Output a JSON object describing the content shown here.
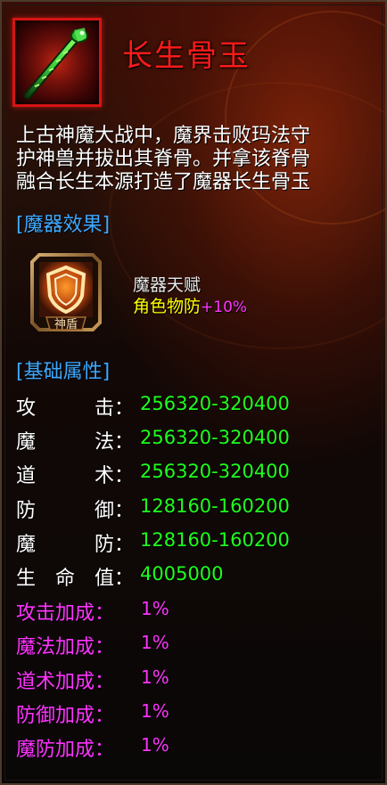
{
  "item": {
    "name": "长生骨玉",
    "icon": "green-bone-staff-icon",
    "description_lines": [
      "上古神魔大战中，魔界击败玛法守",
      "护神兽并拔出其脊骨。并拿该脊骨",
      "融合长生本源打造了魔器长生骨玉"
    ]
  },
  "artifact_effect": {
    "header": "[魔器效果]",
    "talent_icon": "divine-shield-icon",
    "talent_icon_text": "神盾",
    "talent_title": "魔器天赋",
    "stat_name": "角色物防",
    "stat_value": "+10%"
  },
  "base_attributes": {
    "header": "[基础属性]",
    "rows": [
      {
        "label": [
          "攻",
          "",
          "击"
        ],
        "colon": "：",
        "value": "256320-320400"
      },
      {
        "label": [
          "魔",
          "",
          "法"
        ],
        "colon": "：",
        "value": "256320-320400"
      },
      {
        "label": [
          "道",
          "",
          "术"
        ],
        "colon": "：",
        "value": "256320-320400"
      },
      {
        "label": [
          "防",
          "",
          "御"
        ],
        "colon": "：",
        "value": "128160-160200"
      },
      {
        "label": [
          "魔",
          "",
          "防"
        ],
        "colon": "：",
        "value": "128160-160200"
      },
      {
        "label": [
          "生",
          "命",
          "值"
        ],
        "colon": "：",
        "value": "4005000"
      }
    ],
    "bonuses": [
      {
        "label": "攻击加成：",
        "value": "1%"
      },
      {
        "label": "魔法加成：",
        "value": "1%"
      },
      {
        "label": "道术加成：",
        "value": "1%"
      },
      {
        "label": "防御加成：",
        "value": "1%"
      },
      {
        "label": "魔防加成：",
        "value": "1%"
      }
    ]
  },
  "colors": {
    "item_name": "#ff1a1a",
    "section_header": "#3fa9ff",
    "attr_value": "#1eff1e",
    "bonus": "#ff33ff",
    "talent_stat": "#ffff00"
  }
}
